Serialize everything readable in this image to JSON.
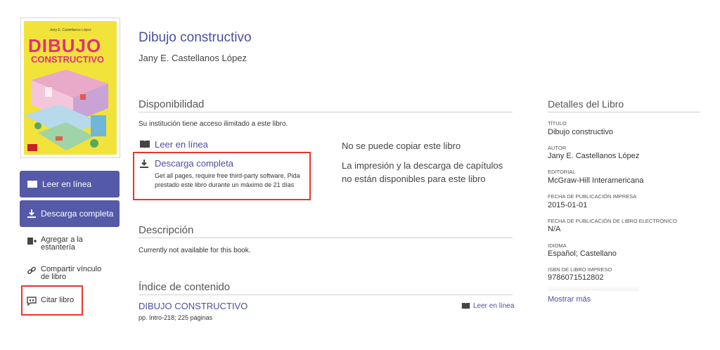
{
  "cover": {
    "author": "Jany E. Castellanos López",
    "title_line1": "DIBUJO",
    "title_line2": "CONSTRUCTIVO"
  },
  "sidebar": {
    "read_online": "Leer en línea",
    "download_full": "Descarga completa",
    "add_shelf": "Agregar a la estantería",
    "share_link": "Compartir vínculo de libro",
    "cite": "Citar libro"
  },
  "book": {
    "title": "Dibujo constructivo",
    "author": "Jany E. Castellanos López"
  },
  "availability": {
    "heading": "Disponibilidad",
    "access_text": "Su institución tiene acceso ilimitado a este libro.",
    "read_online": "Leer en línea",
    "download_title": "Descarga completa",
    "download_line1": "Get all pages, require free third-party software, Pida",
    "download_line2": "prestado este libro durante un máximo de 21 días",
    "no_copy": "No se puede copiar este libro",
    "print_line1": "La impresión y la descarga de capítulos",
    "print_line2": "no están disponibles para este libro"
  },
  "description": {
    "heading": "Descripción",
    "text": "Currently not available for this book."
  },
  "toc": {
    "heading": "Índice de contenido",
    "chapter_title": "DIBUJO CONSTRUCTIVO",
    "chapter_pages": "pp. Intro-218; 225 páginas",
    "read_online": "Leer en línea"
  },
  "details": {
    "heading": "Detalles del Libro",
    "items": [
      {
        "label": "TÍTULO",
        "value": "Dibujo constructivo"
      },
      {
        "label": "AUTOR",
        "value": "Jany E. Castellanos López"
      },
      {
        "label": "EDITORIAL",
        "value": "McGraw-Hill Interamericana"
      },
      {
        "label": "FECHA DE PUBLICACIÓN IMPRESA",
        "value": "2015-01-01"
      },
      {
        "label": "FECHA DE PUBLICACIÓN DE LIBRO ELECTRÓNICO",
        "value": "N/A"
      },
      {
        "label": "IDIOMA",
        "value": "Español; Castellano"
      },
      {
        "label": "ISBN DE LIBRO IMPRESO",
        "value": "9786071512802"
      }
    ],
    "show_more": "Mostrar más"
  },
  "colors": {
    "accent": "#4b4fa0",
    "button": "#5459a8",
    "highlight": "#e8362b",
    "cover_bg": "#f1e33a",
    "cover_title": "#e0317e"
  },
  "icons": {
    "book": "book-icon",
    "download": "download-icon",
    "shelf": "add-shelf-icon",
    "link": "link-icon",
    "cite": "quote-icon"
  }
}
